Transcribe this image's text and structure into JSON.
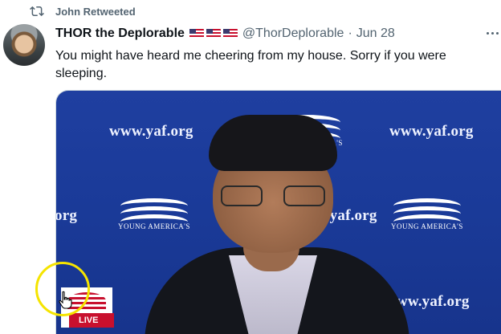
{
  "retweet": {
    "icon": "retweet-icon",
    "text": "John Retweeted"
  },
  "tweet": {
    "author": {
      "display_name": "THOR the Deplorable",
      "flags": [
        "us-flag",
        "us-flag",
        "us-flag"
      ],
      "handle": "@ThorDeplorable",
      "separator": "·",
      "date": "Jun 28"
    },
    "text": "You might have heard me cheering from my house. Sorry if you were sleeping.",
    "more_icon": "more-dots-icon",
    "media": {
      "watermark_url": "www.yaf.org",
      "watermark_partial": "org",
      "logo_text": "YOUNG AMERICA'S",
      "live_label": "LIVE"
    }
  },
  "colors": {
    "secondary_text": "#536471",
    "backdrop_blue": "#1f3fa0",
    "highlight_circle": "#f5e400"
  }
}
